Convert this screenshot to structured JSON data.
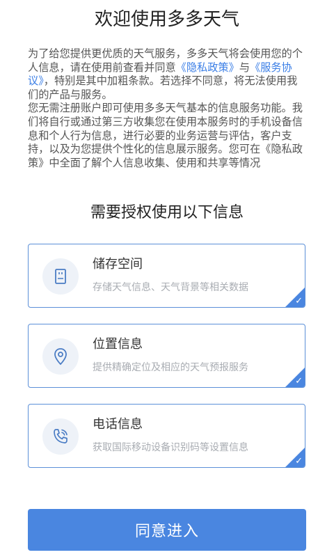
{
  "title": "欢迎使用多多天气",
  "intro": {
    "p1_part1": "为了给您提供更优质的天气服务，多多天气将会使用您的个人信息，请在使用前查看并同意",
    "privacy_link": "《隐私政策》",
    "p1_and": "与",
    "service_link": "《服务协议》",
    "p1_part2": "，特别是其中加粗条款。若选择不同意，将无法使用我们的产品与服务。",
    "p2_part1": "您无需注册账户即可使用多多天气基本的信息服务功能。我们将自行或通过第三方收集您在使用本服务时的手机设备信息和个人行为信息，进行必要的业务运营与评估，客户支持，以及为您提供个性化的信息展示服务。您可在",
    "privacy_link_2": "《隐私政策》",
    "p2_part2": "中全面了解个人信息收集、使用和共享等情况"
  },
  "subtitle": "需要授权使用以下信息",
  "permissions": [
    {
      "title": "储存空间",
      "desc": "存储天气信息、天气背景等相关数据",
      "icon": "storage-icon",
      "checked": true
    },
    {
      "title": "位置信息",
      "desc": "提供精确定位及相应的天气预报服务",
      "icon": "location-pin-icon",
      "checked": true
    },
    {
      "title": "电话信息",
      "desc": "获取国际移动设备识别码等设置信息",
      "icon": "phone-icon",
      "checked": true
    }
  ],
  "check_glyph": "✓",
  "agree_button": "同意进入",
  "colors": {
    "accent": "#4a86e0",
    "card_border": "#5b8fd8",
    "link": "#3a7ee6",
    "icon_bg": "#eef2f8",
    "icon_stroke": "#4a7cc4"
  }
}
